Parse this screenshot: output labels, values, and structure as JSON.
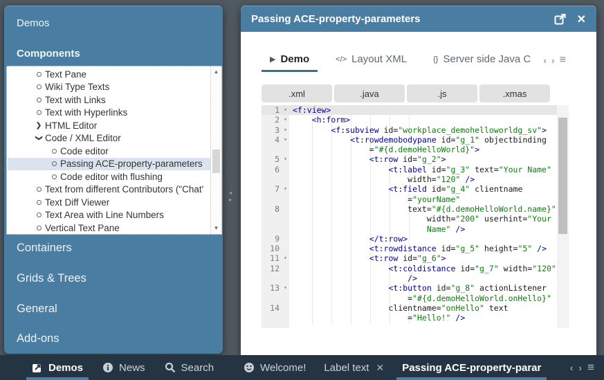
{
  "colors": {
    "accent": "#4a7da2",
    "background": "#505a61",
    "taskbar": "#243442",
    "selection": "#dbe3ee",
    "active_underline": "#35708e",
    "taskbar_underline": "#4d7ea6",
    "button_bg": "#e2e2e2",
    "code_tag": "#0000a0",
    "code_attr": "#1a1a1a",
    "code_string": "#0e7d0e"
  },
  "icons": {
    "scroll_up": "▲",
    "scroll_down": "▼",
    "fold": "▾",
    "hamburger": "≡",
    "chevron_left": "‹",
    "chevron_right": "›",
    "splitter_left": "◂",
    "splitter_right": "▸",
    "close": "✕",
    "play": "▶",
    "code_glyph": "</>",
    "braces_glyph": "{}"
  },
  "left_window": {
    "sections_top": [
      {
        "label": "Demos"
      },
      {
        "label": "Components"
      }
    ],
    "tree": {
      "items": [
        {
          "label": "Text Pane",
          "type": "leaf",
          "level": 1
        },
        {
          "label": "Wiki Type Texts",
          "type": "leaf",
          "level": 1
        },
        {
          "label": "Text with Links",
          "type": "leaf",
          "level": 1
        },
        {
          "label": "Text with Hyperlinks",
          "type": "leaf",
          "level": 1
        },
        {
          "label": "HTML Editor",
          "type": "collapsed",
          "level": 1
        },
        {
          "label": "Code / XML Editor",
          "type": "expanded",
          "level": 1
        },
        {
          "label": "Code editor",
          "type": "leaf",
          "level": 2
        },
        {
          "label": "Passing ACE-property-parameters",
          "type": "leaf",
          "level": 2,
          "selected": true
        },
        {
          "label": "Code editor with flushing",
          "type": "leaf",
          "level": 2
        },
        {
          "label": "Text from different Contributors (\"Chat'",
          "type": "leaf",
          "level": 1
        },
        {
          "label": "Text Diff Viewer",
          "type": "leaf",
          "level": 1
        },
        {
          "label": "Text Area with Line Numbers",
          "type": "leaf",
          "level": 1
        },
        {
          "label": "Vertical Text Pane",
          "type": "leaf",
          "level": 1
        }
      ]
    },
    "sections_bottom": [
      {
        "label": "Containers"
      },
      {
        "label": "Grids & Trees"
      },
      {
        "label": "General"
      },
      {
        "label": "Add-ons"
      }
    ]
  },
  "doc_window": {
    "title": "Passing ACE-property-parameters",
    "tabs": [
      {
        "label": "Demo",
        "icon": "play",
        "active": true
      },
      {
        "label": "Layout XML",
        "icon": "code_glyph",
        "active": false
      },
      {
        "label": "Server side Java C",
        "icon": "braces_glyph",
        "active": false
      }
    ],
    "buttons": [
      ".xml",
      ".java",
      ".js",
      ".xmas"
    ],
    "code": {
      "rows": [
        {
          "n": "1",
          "f": true,
          "hl": true,
          "s": [
            [
              "t",
              "<f:view>"
            ]
          ]
        },
        {
          "n": "2",
          "f": true,
          "s": [
            [
              "a",
              "    "
            ],
            [
              "t",
              "<h:form>"
            ]
          ]
        },
        {
          "n": "3",
          "f": true,
          "s": [
            [
              "a",
              "        "
            ],
            [
              "t",
              "<f:subview"
            ],
            [
              "a",
              " id="
            ],
            [
              "s",
              "\"workplace_demohelloworldg_sv\""
            ],
            [
              "t",
              ">"
            ]
          ]
        },
        {
          "n": "4",
          "f": true,
          "s": [
            [
              "a",
              "            "
            ],
            [
              "t",
              "<t:rowdemobodypane"
            ],
            [
              "a",
              " id="
            ],
            [
              "s",
              "\"g_1\""
            ],
            [
              "a",
              " objectbinding"
            ]
          ]
        },
        {
          "n": "",
          "s": [
            [
              "a",
              "                ="
            ],
            [
              "s",
              "\"#{d.demoHelloWorld}\""
            ],
            [
              "t",
              ">"
            ]
          ]
        },
        {
          "n": "5",
          "f": true,
          "s": [
            [
              "a",
              "                "
            ],
            [
              "t",
              "<t:row"
            ],
            [
              "a",
              " id="
            ],
            [
              "s",
              "\"g_2\""
            ],
            [
              "t",
              ">"
            ]
          ]
        },
        {
          "n": "6",
          "s": [
            [
              "a",
              "                    "
            ],
            [
              "t",
              "<t:label"
            ],
            [
              "a",
              " id="
            ],
            [
              "s",
              "\"g_3\""
            ],
            [
              "a",
              " text="
            ],
            [
              "s",
              "\"Your Name\""
            ]
          ]
        },
        {
          "n": "",
          "s": [
            [
              "a",
              "                        width="
            ],
            [
              "s",
              "\"120\""
            ],
            [
              "t",
              " />"
            ]
          ]
        },
        {
          "n": "7",
          "f": true,
          "s": [
            [
              "a",
              "                    "
            ],
            [
              "t",
              "<t:field"
            ],
            [
              "a",
              " id="
            ],
            [
              "s",
              "\"g_4\""
            ],
            [
              "a",
              " clientname"
            ]
          ]
        },
        {
          "n": "",
          "s": [
            [
              "a",
              "                        ="
            ],
            [
              "s",
              "\"yourName\""
            ]
          ]
        },
        {
          "n": "8",
          "s": [
            [
              "a",
              "                        text="
            ],
            [
              "s",
              "\"#{d.demoHelloWorld.name}\""
            ]
          ]
        },
        {
          "n": "",
          "s": [
            [
              "a",
              "                            width="
            ],
            [
              "s",
              "\"200\""
            ],
            [
              "a",
              " userhint="
            ],
            [
              "s",
              "\"Your"
            ]
          ]
        },
        {
          "n": "",
          "s": [
            [
              "s",
              "                            Name\""
            ],
            [
              "t",
              " />"
            ]
          ]
        },
        {
          "n": "9",
          "s": [
            [
              "a",
              "                "
            ],
            [
              "t",
              "</t:row>"
            ]
          ]
        },
        {
          "n": "10",
          "s": [
            [
              "a",
              "                "
            ],
            [
              "t",
              "<t:rowdistance"
            ],
            [
              "a",
              " id="
            ],
            [
              "s",
              "\"g_5\""
            ],
            [
              "a",
              " height="
            ],
            [
              "s",
              "\"5\""
            ],
            [
              "t",
              " />"
            ]
          ]
        },
        {
          "n": "11",
          "f": true,
          "s": [
            [
              "a",
              "                "
            ],
            [
              "t",
              "<t:row"
            ],
            [
              "a",
              " id="
            ],
            [
              "s",
              "\"g_6\""
            ],
            [
              "t",
              ">"
            ]
          ]
        },
        {
          "n": "12",
          "s": [
            [
              "a",
              "                    "
            ],
            [
              "t",
              "<t:coldistance"
            ],
            [
              "a",
              " id="
            ],
            [
              "s",
              "\"g_7\""
            ],
            [
              "a",
              " width="
            ],
            [
              "s",
              "\"120\""
            ]
          ]
        },
        {
          "n": "",
          "s": [
            [
              "t",
              "                        />"
            ]
          ]
        },
        {
          "n": "13",
          "f": true,
          "s": [
            [
              "a",
              "                    "
            ],
            [
              "t",
              "<t:button"
            ],
            [
              "a",
              " id="
            ],
            [
              "s",
              "\"g_8\""
            ],
            [
              "a",
              " actionListener"
            ]
          ]
        },
        {
          "n": "",
          "s": [
            [
              "a",
              "                        ="
            ],
            [
              "s",
              "\"#{d.demoHelloWorld.onHello}\""
            ]
          ]
        },
        {
          "n": "14",
          "s": [
            [
              "a",
              "                    clientname="
            ],
            [
              "s",
              "\"onHello\""
            ],
            [
              "a",
              " text"
            ]
          ]
        },
        {
          "n": "",
          "s": [
            [
              "a",
              "                        ="
            ],
            [
              "s",
              "\"Hello!\""
            ],
            [
              "t",
              " />"
            ]
          ]
        }
      ]
    }
  },
  "taskbar": {
    "left": [
      {
        "label": "Demos",
        "icon": "demos",
        "active": true
      },
      {
        "label": "News",
        "icon": "info",
        "active": false
      },
      {
        "label": "Search",
        "icon": "search",
        "active": false
      }
    ],
    "right": [
      {
        "label": "Welcome!",
        "icon": "smiley",
        "active": false
      },
      {
        "label": "Label text",
        "close": true,
        "active": false
      },
      {
        "label": "Passing ACE-property-parar",
        "active": true
      }
    ]
  }
}
